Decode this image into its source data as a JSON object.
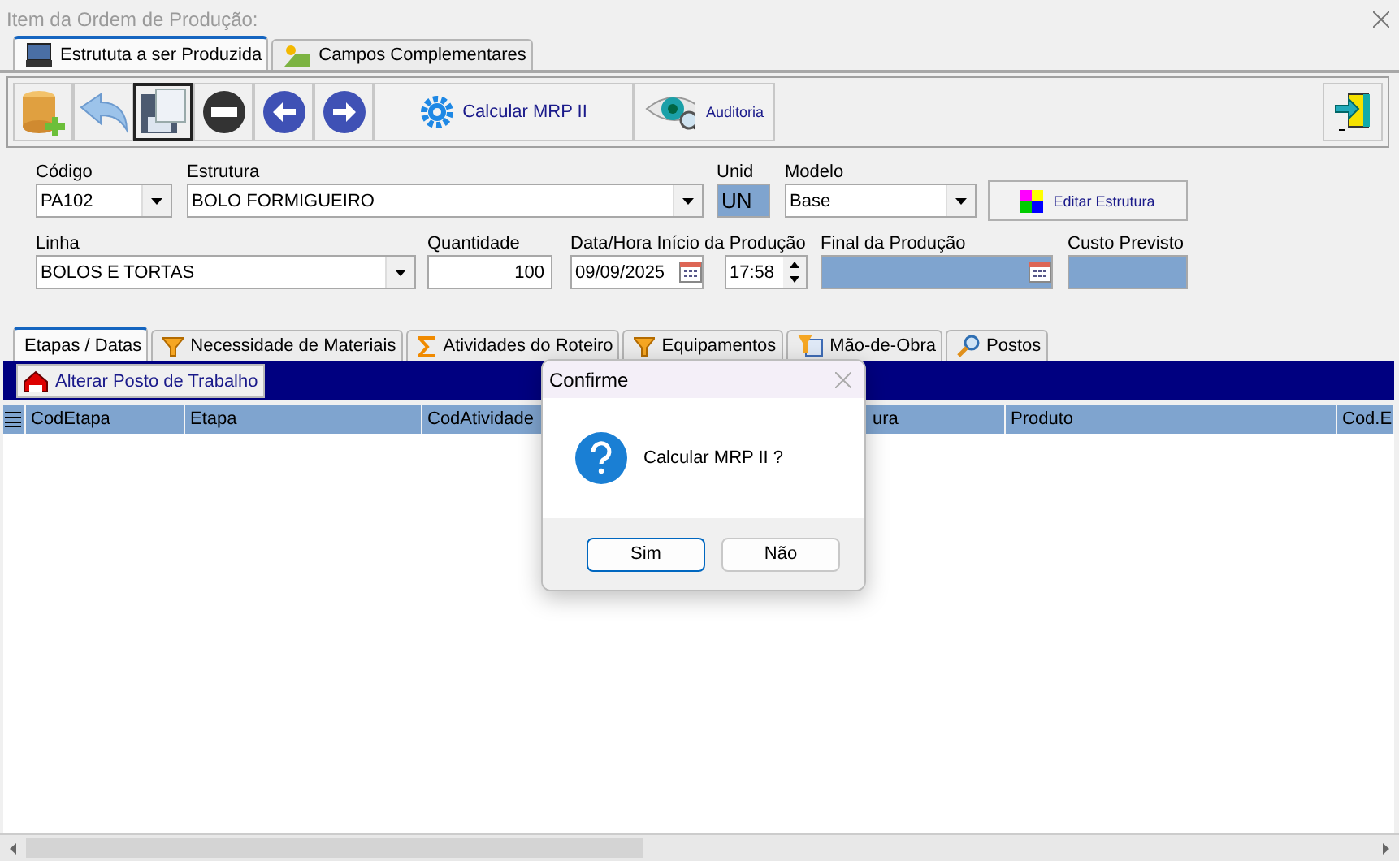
{
  "window": {
    "title": "Item da Ordem de Produção:"
  },
  "top_tabs": [
    {
      "label": "Estrututa a ser Produzida",
      "selected": true
    },
    {
      "label": "Campos Complementares",
      "selected": false
    }
  ],
  "toolbar": {
    "icon_buttons": [
      {
        "focused": false
      },
      {
        "focused": false
      },
      {
        "focused": true
      },
      {
        "focused": false
      },
      {
        "focused": false
      },
      {
        "focused": false
      }
    ],
    "text_buttons": [
      {
        "label": "Calcular MRP II"
      },
      {
        "label": "Auditoria"
      }
    ]
  },
  "form": {
    "codigo": {
      "label": "Código",
      "value": "PA102"
    },
    "estrutura": {
      "label": "Estrutura",
      "value": "BOLO FORMIGUEIRO"
    },
    "unid": {
      "label": "Unid",
      "value": "UN"
    },
    "modelo": {
      "label": "Modelo",
      "value": "Base"
    },
    "editar_button": "Editar Estrutura",
    "linha": {
      "label": "Linha",
      "value": "BOLOS E TORTAS"
    },
    "quantidade": {
      "label": "Quantidade",
      "value": "100"
    },
    "inicio": {
      "label": "Data/Hora Início da Produção",
      "date": "09/09/2025",
      "time": "17:58"
    },
    "final": {
      "label": "Final da Produção"
    },
    "custo": {
      "label": "Custo Previsto"
    }
  },
  "lower_tabs": [
    {
      "label": "Etapas / Datas",
      "selected": true
    },
    {
      "label": "Necessidade de Materiais",
      "selected": false
    },
    {
      "label": "Atividades do Roteiro",
      "selected": false
    },
    {
      "label": "Equipamentos",
      "selected": false
    },
    {
      "label": "Mão-de-Obra",
      "selected": false
    },
    {
      "label": "Postos",
      "selected": false
    }
  ],
  "grid_toolbar": {
    "button": "Alterar Posto de Trabalho"
  },
  "table": {
    "columns": [
      "CodEtapa",
      "Etapa",
      "CodAtividade",
      "ura",
      "Produto",
      "Cod.E"
    ]
  },
  "dialog": {
    "title": "Confirme",
    "message": "Calcular MRP II ?",
    "buttons": [
      {
        "label": "Sim",
        "focused": true
      },
      {
        "label": "Não",
        "focused": false
      }
    ]
  }
}
